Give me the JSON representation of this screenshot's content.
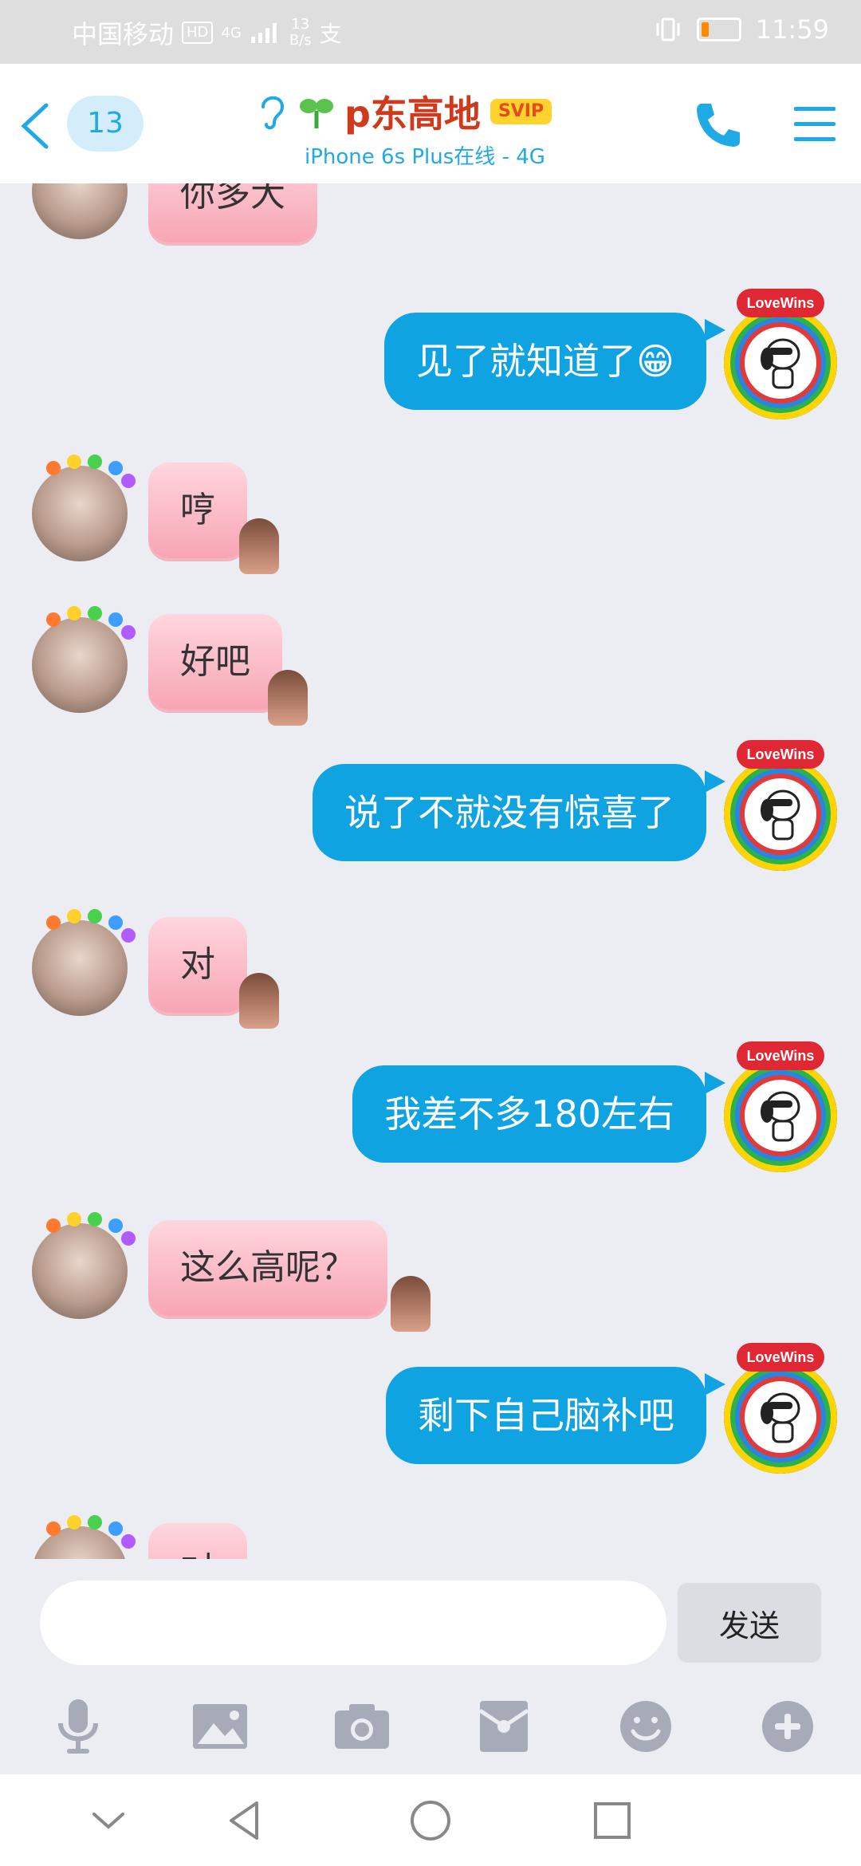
{
  "status_bar": {
    "carrier": "中国移动",
    "hd": "HD",
    "signal": "4G",
    "speed_value": "13",
    "speed_unit": "B/s",
    "time": "11:59",
    "battery_level": 0.2
  },
  "header": {
    "unread_count": "13",
    "contact_name": "p东高地",
    "svip": "SVIP",
    "subtitle": "iPhone 6s Plus在线 - 4G"
  },
  "messages": [
    {
      "side": "left",
      "text": "你多大"
    },
    {
      "side": "right",
      "text": "见了就知道了😁",
      "badge": "LoveWins"
    },
    {
      "side": "left",
      "text": "哼"
    },
    {
      "side": "left",
      "text": "好吧"
    },
    {
      "side": "right",
      "text": "说了不就没有惊喜了",
      "badge": "LoveWins"
    },
    {
      "side": "left",
      "text": "对"
    },
    {
      "side": "right",
      "text": "我差不多180左右",
      "badge": "LoveWins"
    },
    {
      "side": "left",
      "text": "这么高呢？"
    },
    {
      "side": "right",
      "text": "剩下自己脑补吧",
      "badge": "LoveWins"
    },
    {
      "side": "left",
      "text": "对"
    }
  ],
  "input": {
    "placeholder": "",
    "send_label": "发送"
  },
  "toolbar_icons": [
    "microphone-icon",
    "image-icon",
    "camera-icon",
    "red-packet-icon",
    "emoji-icon",
    "plus-icon"
  ],
  "nav_icons": [
    "down-chevron-icon",
    "back-triangle-icon",
    "home-circle-icon",
    "recents-square-icon"
  ],
  "colors": {
    "accent": "#0fa3e1",
    "name": "#cf3a1d",
    "svip": "#ffd22e"
  }
}
